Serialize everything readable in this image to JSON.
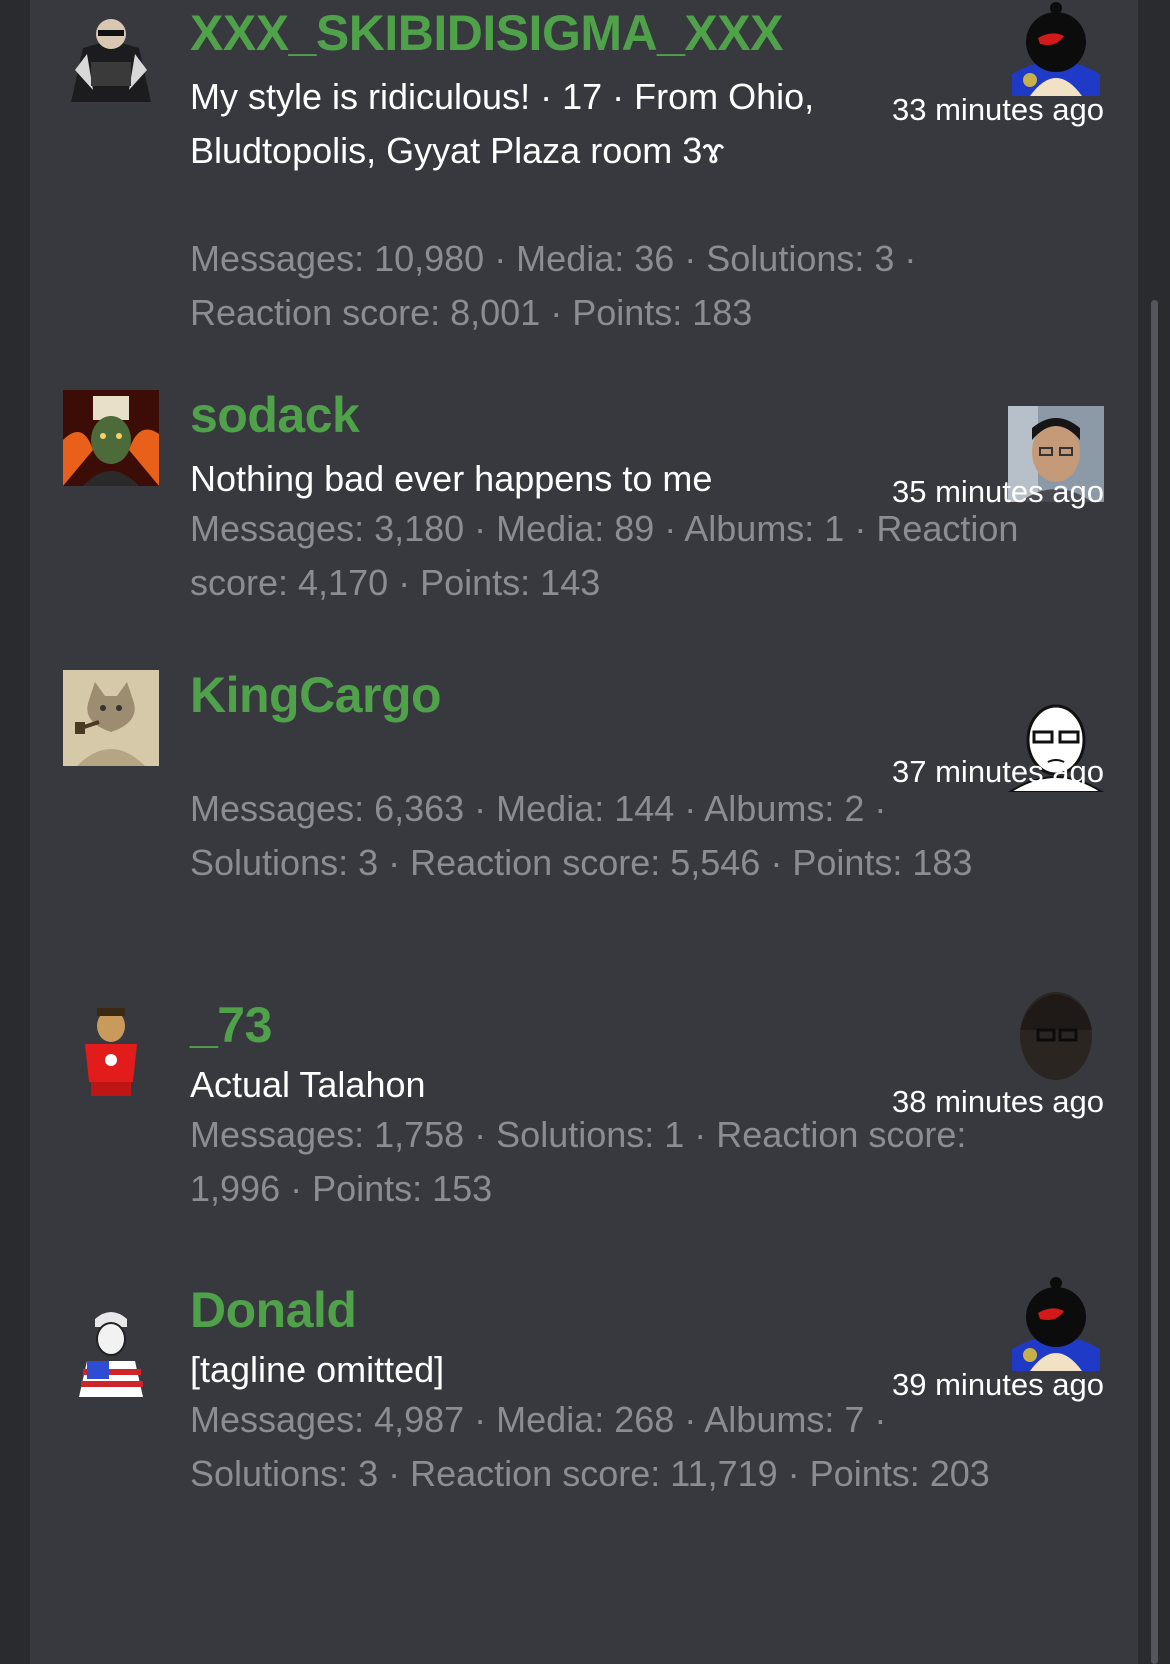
{
  "members": [
    {
      "avatar_icon": "caped-hacker-avatar",
      "name": "XXX_SKIBIDISIGMA_XXX",
      "tagline": "My style is ridiculous! · 17 · From Ohio, Bludtopolis, Gyyat Plaza room 3ɤ",
      "stats": "Messages: 10,980 · Media: 36 · Solutions: 3 · Reaction score: 8,001 · Points: 183",
      "time": "33 minutes ago",
      "reactor_icon": "hooded-penguin-reactor-icon"
    },
    {
      "avatar_icon": "warlord-avatar",
      "name": "sodack",
      "tagline": "Nothing bad ever happens to me",
      "stats": "Messages: 3,180 · Media: 89 · Albums: 1 · Reaction score: 4,170 · Points: 143",
      "time": "35 minutes ago",
      "reactor_icon": "face-photo-reactor-icon"
    },
    {
      "avatar_icon": "pipe-cat-sketch-avatar",
      "name": "KingCargo",
      "tagline": "",
      "stats": "Messages: 6,363 · Media: 144 · Albums: 2 · Solutions: 3 · Reaction score: 5,546 · Points: 183",
      "time": "37 minutes ago",
      "reactor_icon": "glasses-wojak-reactor-icon"
    },
    {
      "avatar_icon": "red-shirt-man-avatar",
      "name": "_73",
      "tagline": "Actual Talahon",
      "stats": "Messages: 1,758 · Solutions: 1 · Reaction score: 1,996 · Points: 153",
      "time": "38 minutes ago",
      "reactor_icon": "dark-wojak-reactor-icon"
    },
    {
      "avatar_icon": "flag-shirt-man-avatar",
      "name": "Donald",
      "tagline": "[tagline omitted]",
      "stats": "Messages: 4,987 · Media: 268 · Albums: 7 · Solutions: 3 · Reaction score: 11,719 · Points: 203",
      "time": "39 minutes ago",
      "reactor_icon": "hooded-penguin-reactor-icon"
    }
  ],
  "colors": {
    "username": "#4fa24a",
    "stats": "#8a8d92",
    "panel": "#37393e",
    "text": "#ffffff"
  }
}
